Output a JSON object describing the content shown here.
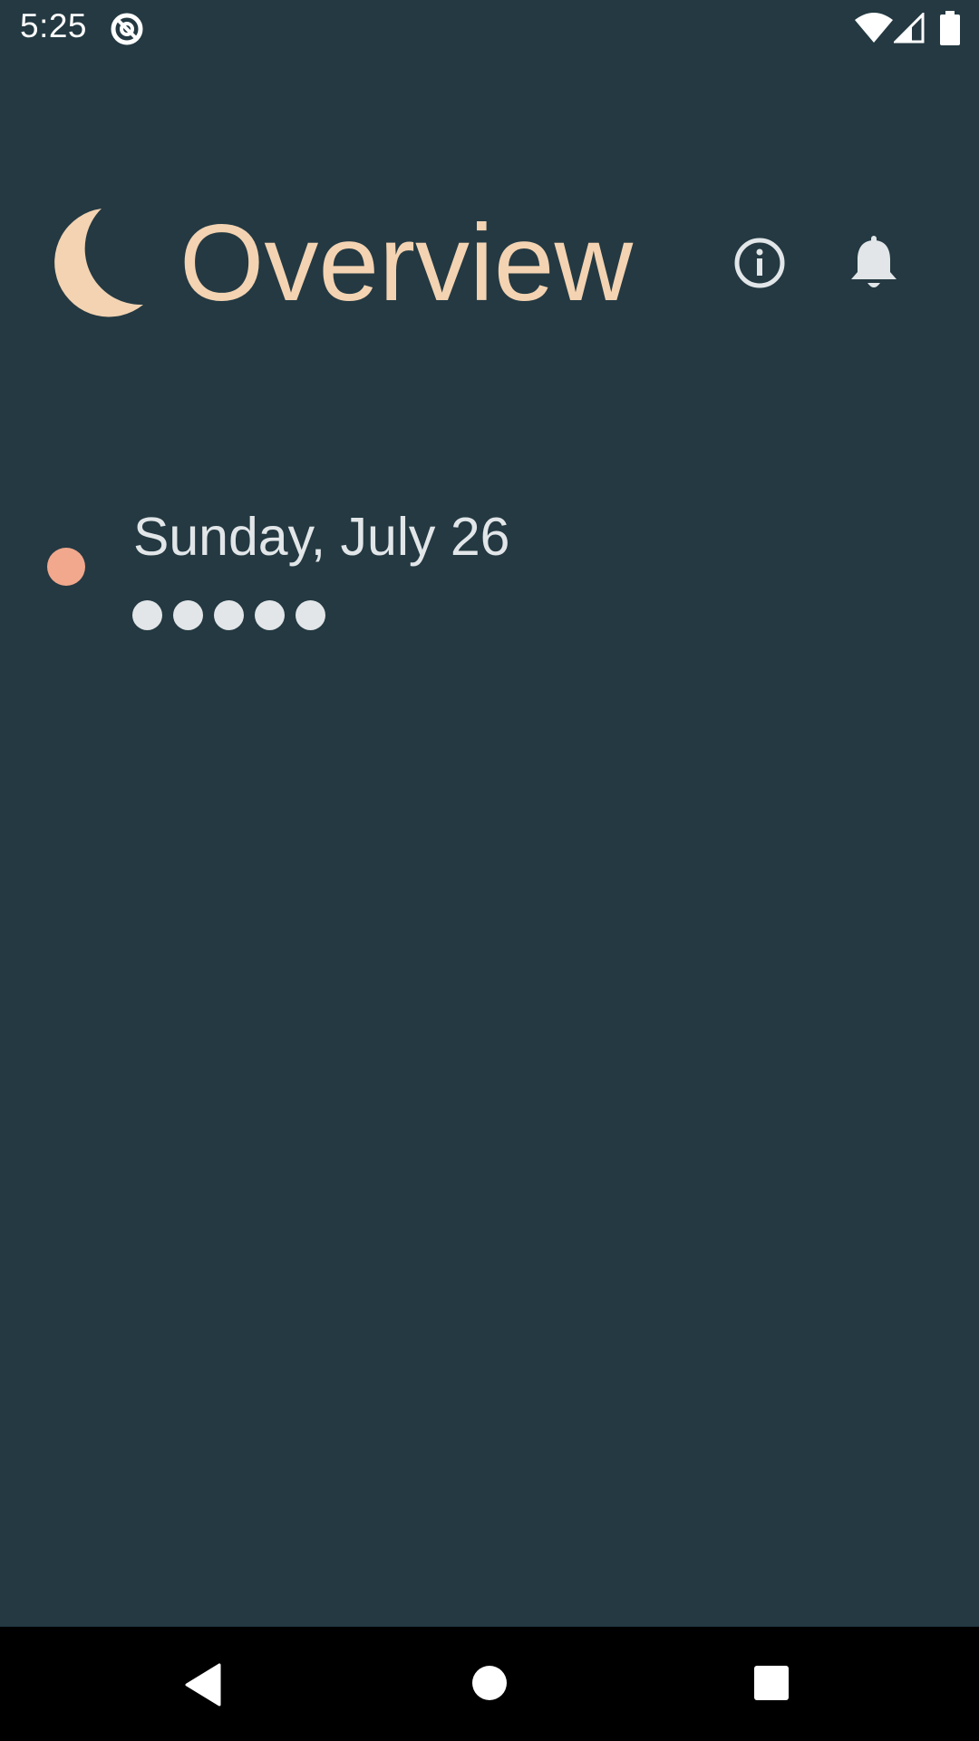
{
  "status_bar": {
    "time": "5:25",
    "app_icon": "do-not-disturb-q-icon",
    "icons": [
      "wifi-icon",
      "cell-signal-icon",
      "battery-icon"
    ]
  },
  "header": {
    "logo_icon": "moon-icon",
    "title": "Overview",
    "actions": [
      "info-icon",
      "bell-icon"
    ]
  },
  "entries": [
    {
      "date": "Sunday, July 26",
      "indicator_color": "#f1a88d",
      "rating": 5,
      "rating_max": 5
    }
  ],
  "colors": {
    "background": "#243942",
    "accent": "#f3d3b2",
    "text": "#e2e6e8",
    "indicator": "#f1a88d",
    "rating_dot": "#e2e6e8",
    "nav_bar": "#000000"
  },
  "nav_bar": {
    "buttons": [
      "back-icon",
      "home-icon",
      "recents-icon"
    ]
  }
}
